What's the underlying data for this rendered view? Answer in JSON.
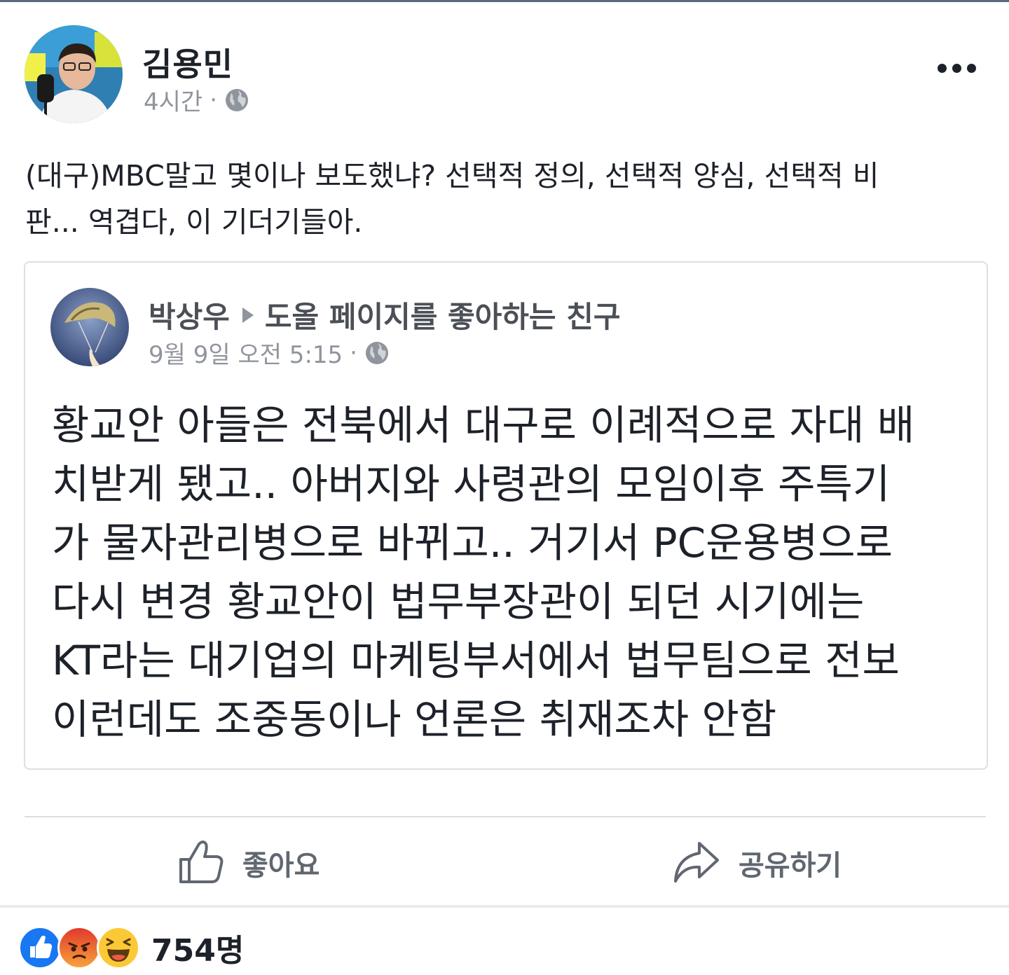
{
  "author": {
    "name": "김용민",
    "time": "4시간",
    "separator": "·"
  },
  "post": {
    "text_lines": [
      "(대구)MBC말고 몇이나 보도했냐? 선택적 정의, 선택적 양심, 선택적 비",
      "판... 역겹다, 이 기더기들아."
    ]
  },
  "shared": {
    "author": "박상우",
    "target": "도올 페이지를 좋아하는 친구",
    "time": "9월 9일 오전 5:15",
    "separator": "·",
    "body_lines": [
      "황교안 아들은 전북에서 대구로 이례적으로 자대 배",
      "치받게 됐고.. 아버지와 사령관의 모임이후  주특기",
      "가 물자관리병으로 바뀌고.. 거기서 PC운용병으로",
      "다시 변경  황교안이 법무부장관이 되던 시기에는",
      "KT라는 대기업의 마케팅부서에서 법무팀으로 전보",
      "이런데도 조중동이나 언론은 취재조차 안함"
    ]
  },
  "actions": {
    "like_label": "좋아요",
    "share_label": "공유하기"
  },
  "reactions": {
    "count": "754명",
    "icons": [
      "like-icon",
      "angry-icon",
      "haha-icon"
    ]
  },
  "colors": {
    "text": "#1d2129",
    "muted": "#90949c",
    "like_blue": "#1877f2",
    "angry_orange": "#f0582c",
    "haha_yellow": "#fcc936"
  }
}
